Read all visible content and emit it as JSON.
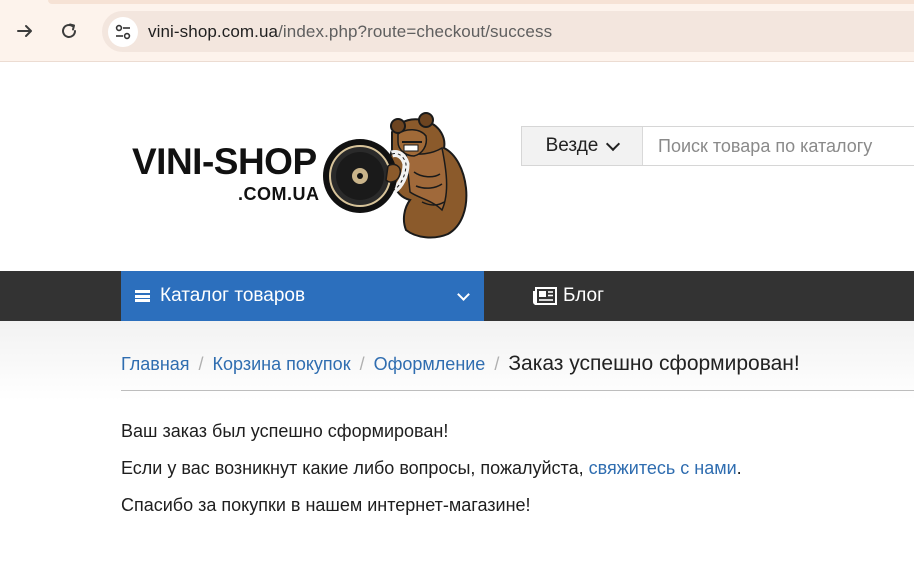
{
  "browser": {
    "url_host": "vini-shop.com.ua",
    "url_path": "/index.php?route=checkout/success"
  },
  "logo": {
    "main": "VINI-SHOP",
    "sub": ".COM.UA"
  },
  "search": {
    "scope": "Везде",
    "placeholder": "Поиск товара по каталогу"
  },
  "menu": {
    "catalog_label": "Каталог товаров",
    "blog_label": "Блог"
  },
  "breadcrumb": {
    "home": "Главная",
    "cart": "Корзина покупок",
    "checkout": "Оформление",
    "current": "Заказ успешно сформирован!"
  },
  "message": {
    "line1": "Ваш заказ был успешно сформирован!",
    "line2_before": "Если у вас возникнут какие либо вопросы, пожалуйста,",
    "line2_link": "свяжитесь с нами",
    "line2_after": ".",
    "line3": "Спасибо за покупки в нашем интернет-магазине!"
  },
  "colors": {
    "accent": "#2c6fbd",
    "menu_bg": "#333333",
    "link": "#2f6db0"
  }
}
